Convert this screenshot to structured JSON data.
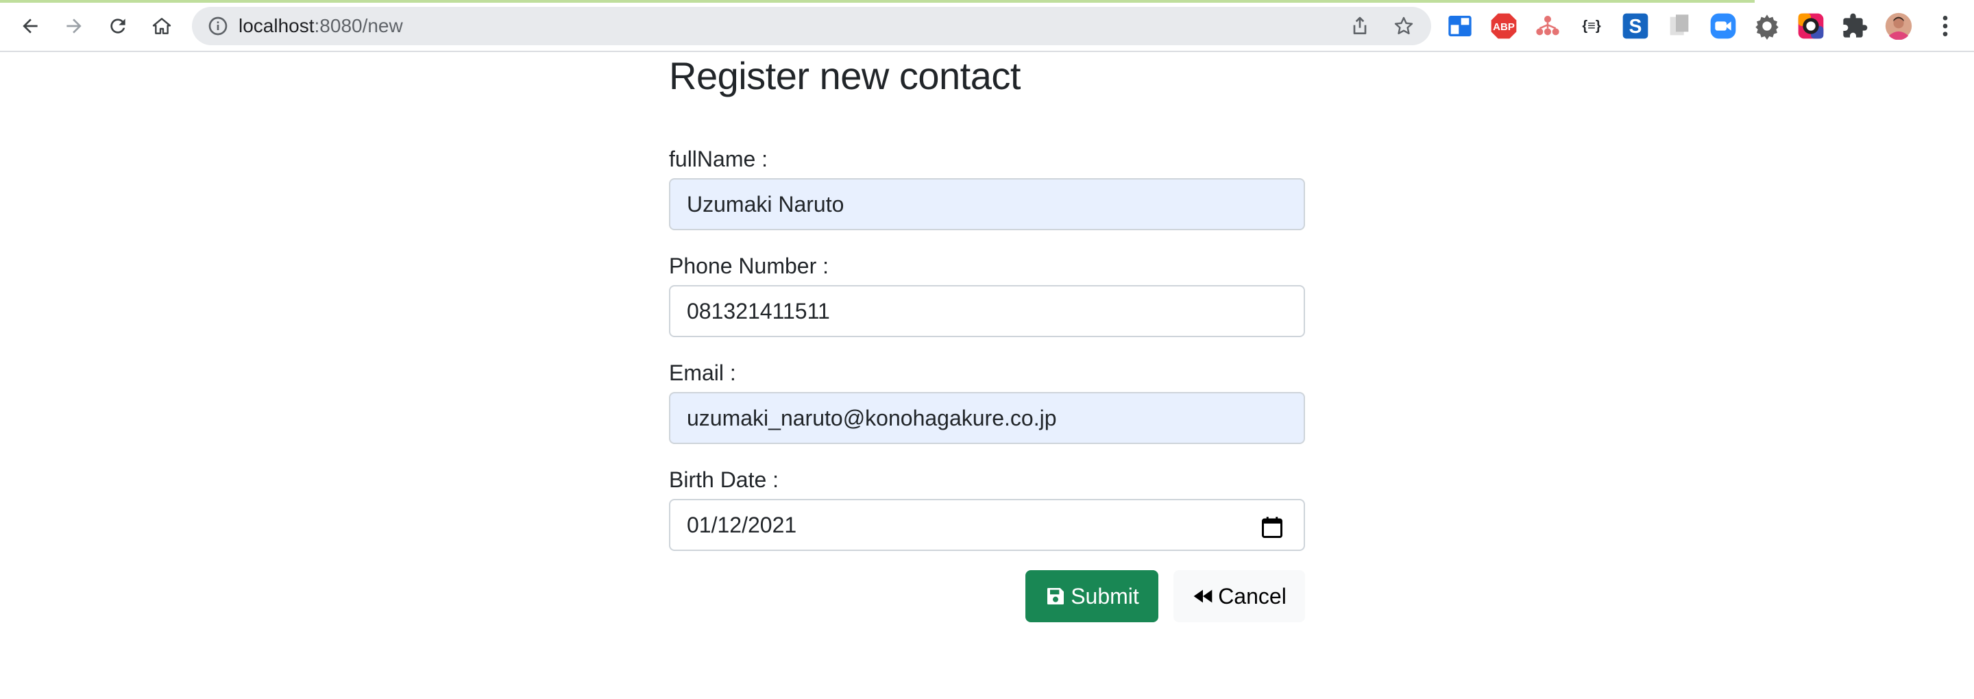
{
  "browser": {
    "url_host": "localhost",
    "url_port_path": ":8080/new",
    "nav": {
      "back_icon": "arrow-left-icon",
      "forward_icon": "arrow-right-icon",
      "reload_icon": "reload-icon",
      "home_icon": "home-icon"
    },
    "extensions": [
      {
        "name": "screen-capture-extension-icon"
      },
      {
        "name": "adblock-plus-extension-icon",
        "label": "ABP"
      },
      {
        "name": "network-extension-icon"
      },
      {
        "name": "json-formatter-extension-icon",
        "label": "{≡}"
      },
      {
        "name": "s-extension-icon",
        "label": "S"
      },
      {
        "name": "document-extension-icon"
      },
      {
        "name": "zoom-extension-icon"
      },
      {
        "name": "gear-extension-icon"
      },
      {
        "name": "color-picker-extension-icon"
      },
      {
        "name": "extensions-puzzle-icon"
      },
      {
        "name": "profile-avatar"
      },
      {
        "name": "kebab-menu-icon"
      }
    ]
  },
  "page": {
    "title": "Register new contact",
    "fields": {
      "full_name": {
        "label": "fullName :",
        "value": "Uzumaki Naruto"
      },
      "phone": {
        "label": "Phone Number :",
        "value": "081321411511"
      },
      "email": {
        "label": "Email :",
        "value": "uzumaki_naruto@konohagakure.co.jp"
      },
      "birth_date": {
        "label": "Birth Date :",
        "value": "01/12/2021"
      }
    },
    "buttons": {
      "submit_label": "Submit",
      "cancel_label": "Cancel"
    }
  },
  "colors": {
    "submit": "#198754",
    "cancel": "#f8f9fa",
    "autofill": "#e8f0fe"
  }
}
